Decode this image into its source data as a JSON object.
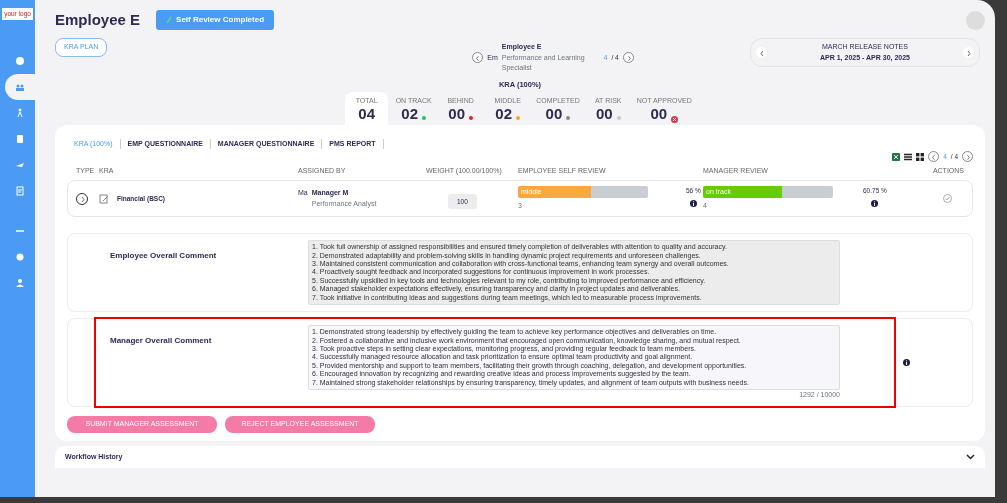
{
  "sidebar": {
    "logo": "your logo",
    "items": [
      {
        "selected": false
      },
      {
        "selected": true
      },
      {
        "selected": false
      },
      {
        "selected": false
      },
      {
        "selected": false
      },
      {
        "selected": false
      },
      {
        "selected": false
      },
      {
        "selected": false
      },
      {
        "selected": false
      }
    ]
  },
  "header": {
    "title": "Employee E",
    "status": "Self Review Completed"
  },
  "kra_plan_button": "KRA PLAN",
  "employee_nav": {
    "name": "Employee E",
    "avatar_alt": "Em",
    "role": "Performance and Learning Specialist",
    "current": "4",
    "total": "/ 4"
  },
  "release_notes": {
    "title": "MARCH RELEASE NOTES",
    "dates": "APR 1, 2025 - APR 30, 2025"
  },
  "summary_title": "KRA (100%)",
  "stats": [
    {
      "label": "TOTAL",
      "value": "04",
      "selected": true,
      "kind": "none"
    },
    {
      "label": "ON TRACK",
      "value": "02",
      "selected": false,
      "kind": "dot",
      "color": "#22c55e"
    },
    {
      "label": "BEHIND",
      "value": "00",
      "selected": false,
      "kind": "dot",
      "color": "#ef1c1c"
    },
    {
      "label": "MIDDLE",
      "value": "02",
      "selected": false,
      "kind": "dot",
      "color": "#f5a623"
    },
    {
      "label": "COMPLETED",
      "value": "00",
      "selected": false,
      "kind": "dot",
      "color": "#8a8a8a"
    },
    {
      "label": "AT RISK",
      "value": "00",
      "selected": false,
      "kind": "dot",
      "color": "#c8c8c8"
    },
    {
      "label": "NOT APPROVED",
      "value": "00",
      "selected": false,
      "kind": "cross",
      "color": "#e0314b"
    }
  ],
  "tabs": [
    {
      "label": "KRA (100%)",
      "selected": true
    },
    {
      "label": "EMP QUESTIONNAIRE",
      "selected": false
    },
    {
      "label": "MANAGER QUESTIONNAIRE",
      "selected": false
    },
    {
      "label": "PMS REPORT",
      "selected": false
    }
  ],
  "pager": {
    "current": "4",
    "total": "/ 4"
  },
  "table": {
    "columns": [
      "TYPE",
      "KRA",
      "ASSIGNED BY",
      "WEIGHT (100.00/100%)",
      "EMPLOYEE SELF REVIEW",
      "MANAGER REVIEW",
      "ACTIONS"
    ],
    "rows": [
      {
        "kra": "Financial (BSC)",
        "assignee": "Manager M",
        "assignee_alt": "Ma",
        "assignee_role": "Performance Analyst",
        "weight": "100",
        "self_review": {
          "label": "middle",
          "level": 0.56,
          "color": "#f9a83e",
          "score": "3",
          "percent": "56 %"
        },
        "manager_review": {
          "label": "on track",
          "level": 0.6075,
          "color": "#66cc00",
          "score": "4",
          "percent": "60.75 %"
        }
      }
    ]
  },
  "comments": [
    {
      "label": "Employee Overall Comment",
      "readonly": true,
      "highlighted": false,
      "info": false,
      "lines": [
        "1. Took full ownership of assigned responsibilities and ensured timely completion of deliverables with attention to quality and accuracy.",
        "2. Demonstrated adaptability and problem-solving skills in handling dynamic project requirements and unforeseen challenges.",
        "3. Maintained consistent communication and collaboration with cross-functional teams, enhancing team synergy and overall outcomes.",
        "4. Proactively sought feedback and incorporated suggestions for continuous improvement in work processes.",
        "5. Successfully upskilled in key tools and technologies relevant to my role, contributing to improved performance and efficiency.",
        "6. Managed stakeholder expectations effectively, ensuring transparency and clarity in project updates and deliverables.",
        "7. Took initiative in contributing ideas and suggestions during team meetings, which led to measurable process improvements."
      ]
    },
    {
      "label": "Manager Overall Comment",
      "readonly": false,
      "highlighted": true,
      "info": true,
      "counter": "1292 / 10000",
      "lines": [
        "1. Demonstrated strong leadership by effectively guiding the team to achieve key performance objectives and deliverables on time.",
        "2. Fostered a collaborative and inclusive work environment that encouraged open communication, knowledge sharing, and mutual respect.",
        "3. Took proactive steps in setting clear expectations, monitoring progress, and providing regular feedback to team members.",
        "4. Successfully managed resource allocation and task prioritization to ensure optimal team productivity and goal alignment.",
        "5. Provided mentorship and support to team members, facilitating their growth through coaching, delegation, and development opportunities.",
        "6. Encouraged innovation by recognizing and rewarding creative ideas and process improvements suggested by the team.",
        "7. Maintained strong stakeholder relationships by ensuring transparency, timely updates, and alignment of team outputs with business needs."
      ]
    }
  ],
  "actions": [
    "SUBMIT MANAGER ASSESSMENT",
    "REJECT EMPLOYEE ASSESSMENT"
  ],
  "workflow": {
    "title": "Workflow History",
    "expanded": false
  }
}
